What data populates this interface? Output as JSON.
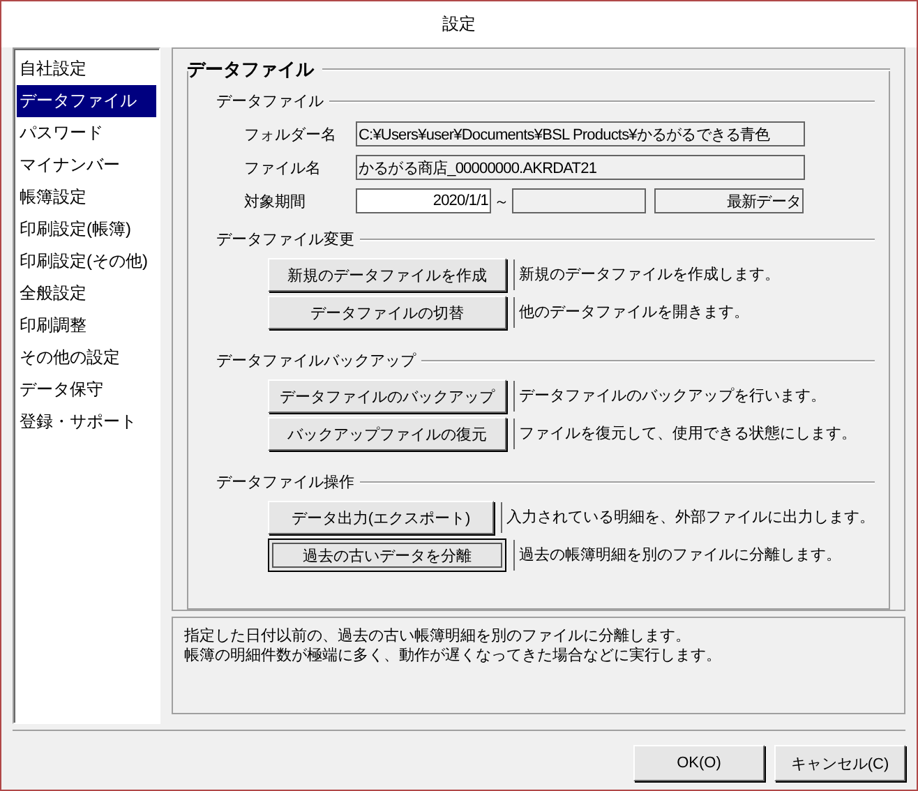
{
  "window": {
    "title": "設定"
  },
  "sidebar": {
    "items": [
      {
        "label": "自社設定",
        "selected": false
      },
      {
        "label": "データファイル",
        "selected": true
      },
      {
        "label": "パスワード",
        "selected": false
      },
      {
        "label": "マイナンバー",
        "selected": false
      },
      {
        "label": "帳簿設定",
        "selected": false
      },
      {
        "label": "印刷設定(帳簿)",
        "selected": false
      },
      {
        "label": "印刷設定(その他)",
        "selected": false
      },
      {
        "label": "全般設定",
        "selected": false
      },
      {
        "label": "印刷調整",
        "selected": false
      },
      {
        "label": "その他の設定",
        "selected": false
      },
      {
        "label": "データ保守",
        "selected": false
      },
      {
        "label": "登録・サポート",
        "selected": false
      }
    ]
  },
  "panel": {
    "title": "データファイル",
    "file_section": {
      "title": "データファイル",
      "folder": {
        "label": "フォルダー名",
        "value": "C:¥Users¥user¥Documents¥BSL Products¥かるがるできる青色"
      },
      "file": {
        "label": "ファイル名",
        "value": "かるがる商店_00000000.AKRDAT21"
      },
      "period": {
        "label": "対象期間",
        "from": "2020/1/1",
        "separator": "～",
        "to_value": "最新データ"
      }
    },
    "sections": [
      {
        "title": "データファイル変更",
        "actions": [
          {
            "button": "新規のデータファイルを作成",
            "description": "新規のデータファイルを作成します。",
            "focused": false
          },
          {
            "button": "データファイルの切替",
            "description": "他のデータファイルを開きます。",
            "focused": false
          }
        ]
      },
      {
        "title": "データファイルバックアップ",
        "actions": [
          {
            "button": "データファイルのバックアップ",
            "description": "データファイルのバックアップを行います。",
            "focused": false
          },
          {
            "button": "バックアップファイルの復元",
            "description": "ファイルを復元して、使用できる状態にします。",
            "focused": false
          }
        ]
      },
      {
        "title": "データファイル操作",
        "actions": [
          {
            "button": "データ出力(エクスポート)",
            "description": "入力されている明細を、外部ファイルに出力します。",
            "focused": false
          },
          {
            "button": "過去の古いデータを分離",
            "description": "過去の帳簿明細を別のファイルに分離します。",
            "focused": true
          }
        ]
      }
    ]
  },
  "help_text": [
    "指定した日付以前の、過去の古い帳簿明細を別のファイルに分離します。",
    "帳簿の明細件数が極端に多く、動作が遅くなってきた場合などに実行します。"
  ],
  "buttons": [
    "OK(O)",
    "キャンセル(C)"
  ]
}
